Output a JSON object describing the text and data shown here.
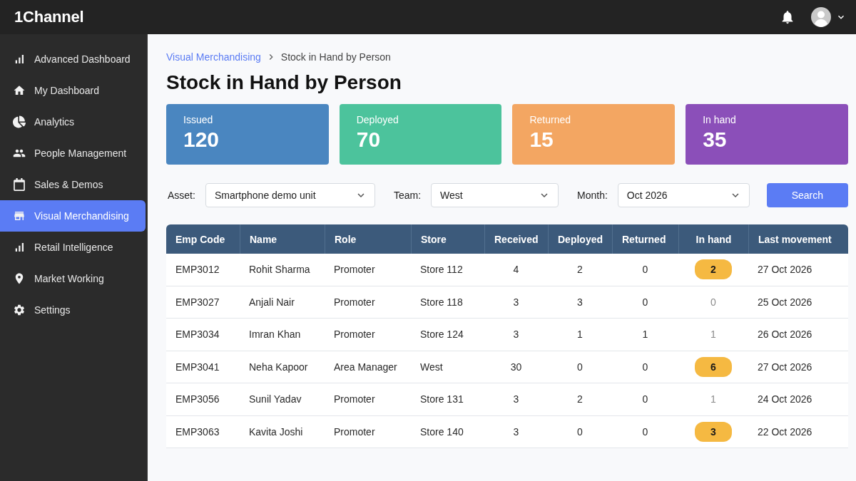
{
  "app": {
    "logo": "1Channel"
  },
  "sidebar": {
    "items": [
      {
        "label": "Advanced Dashboard",
        "selected": false
      },
      {
        "label": "My Dashboard",
        "selected": false
      },
      {
        "label": "Analytics",
        "selected": false
      },
      {
        "label": "People Management",
        "selected": false
      },
      {
        "label": "Sales & Demos",
        "selected": false
      },
      {
        "label": "Visual Merchandising",
        "selected": true
      },
      {
        "label": "Retail Intelligence",
        "selected": false
      },
      {
        "label": "Market Working",
        "selected": false
      },
      {
        "label": "Settings",
        "selected": false
      }
    ]
  },
  "breadcrumb": {
    "parent": "Visual Merchandising",
    "current": "Stock in Hand by Person"
  },
  "page_title": "Stock in Hand by Person",
  "summary_cards": [
    {
      "label": "Issued",
      "value": "120",
      "color": "#4a86c0"
    },
    {
      "label": "Deployed",
      "value": "70",
      "color": "#4cc39c"
    },
    {
      "label": "Returned",
      "value": "15",
      "color": "#f3a662"
    },
    {
      "label": "In hand",
      "value": "35",
      "color": "#8b4fb9"
    }
  ],
  "filters": [
    {
      "label": "Asset:",
      "value": "Smartphone demo unit"
    },
    {
      "label": "Team:",
      "value": "West"
    },
    {
      "label": "Month:",
      "value": "Oct 2026"
    }
  ],
  "search_button": "Search",
  "table": {
    "columns": [
      "Emp Code",
      "Name",
      "Role",
      "Store",
      "Received",
      "Deployed",
      "Returned",
      "In hand",
      "Last movement"
    ],
    "rows": [
      {
        "emp_code": "EMP3012",
        "name": "Rohit Sharma",
        "role": "Promoter",
        "store": "Store 112",
        "received": "4",
        "deployed": "2",
        "returned": "0",
        "in_hand": {
          "value": "2",
          "highlighted": true
        },
        "last_movement": "27 Oct 2026"
      },
      {
        "emp_code": "EMP3027",
        "name": "Anjali Nair",
        "role": "Promoter",
        "store": "Store 118",
        "received": "3",
        "deployed": "3",
        "returned": "0",
        "in_hand": {
          "value": "0",
          "highlighted": false
        },
        "last_movement": "25 Oct 2026"
      },
      {
        "emp_code": "EMP3034",
        "name": "Imran Khan",
        "role": "Promoter",
        "store": "Store 124",
        "received": "3",
        "deployed": "1",
        "returned": "1",
        "in_hand": {
          "value": "1",
          "highlighted": false
        },
        "last_movement": "26 Oct 2026"
      },
      {
        "emp_code": "EMP3041",
        "name": "Neha Kapoor",
        "role": "Area Manager",
        "store": "West",
        "received": "30",
        "deployed": "0",
        "returned": "0",
        "in_hand": {
          "value": "6",
          "highlighted": true
        },
        "last_movement": "27 Oct 2026"
      },
      {
        "emp_code": "EMP3056",
        "name": "Sunil Yadav",
        "role": "Promoter",
        "store": "Store 131",
        "received": "3",
        "deployed": "2",
        "returned": "0",
        "in_hand": {
          "value": "1",
          "highlighted": false
        },
        "last_movement": "24 Oct 2026"
      },
      {
        "emp_code": "EMP3063",
        "name": "Kavita Joshi",
        "role": "Promoter",
        "store": "Store 140",
        "received": "3",
        "deployed": "0",
        "returned": "0",
        "in_hand": {
          "value": "3",
          "highlighted": true
        },
        "last_movement": "22 Oct 2026"
      }
    ]
  }
}
